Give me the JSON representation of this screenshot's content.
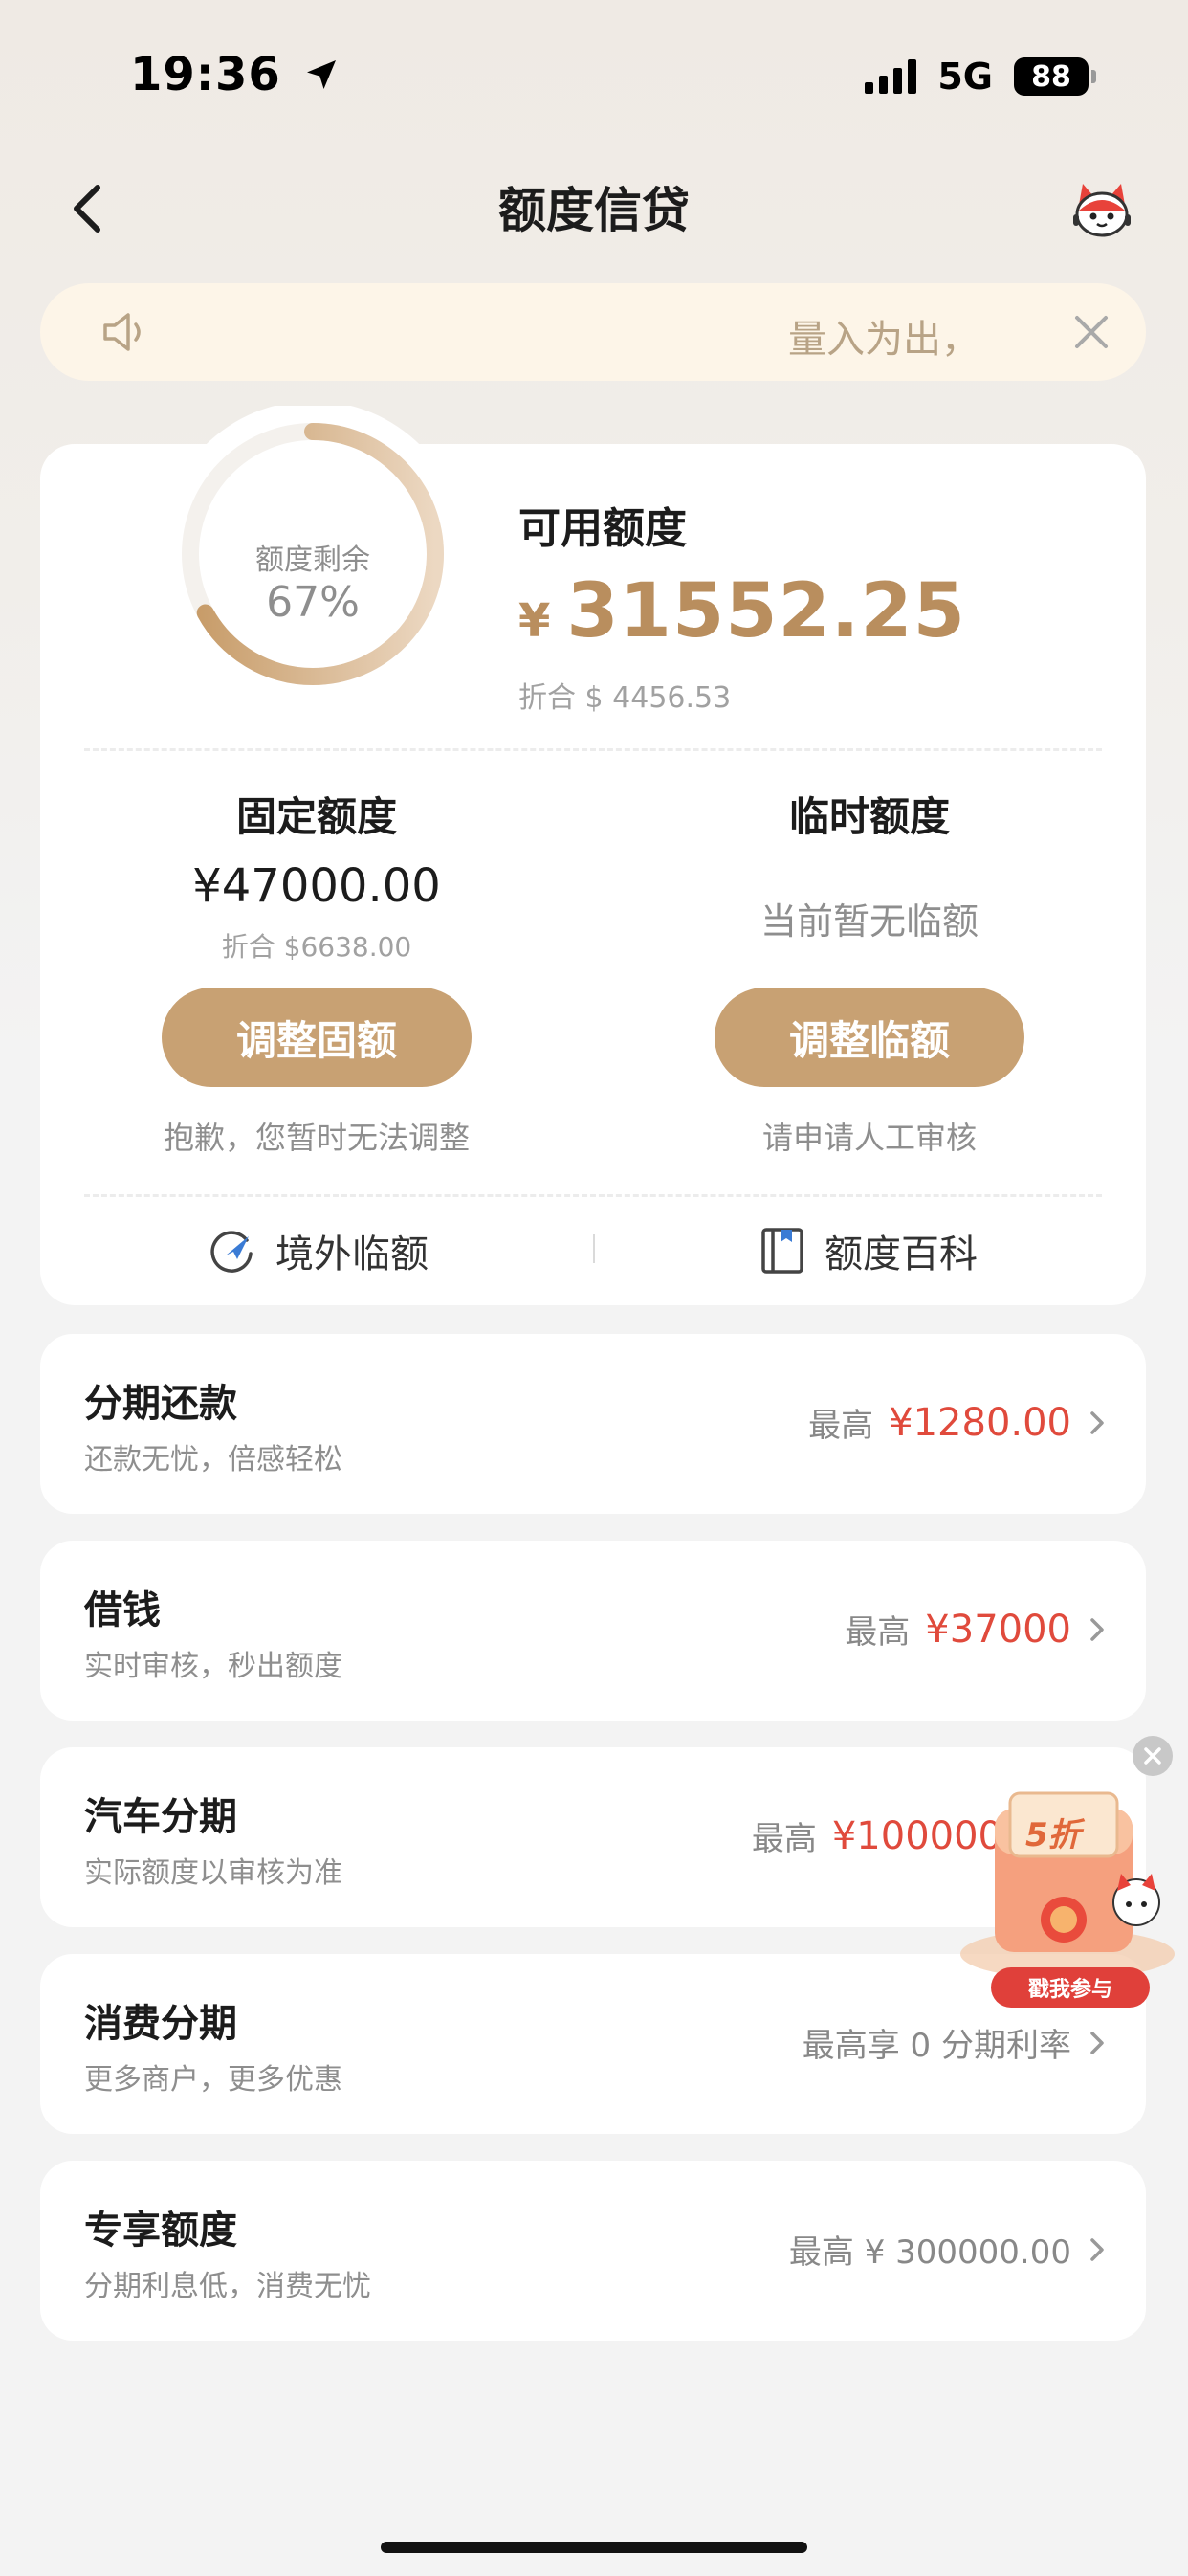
{
  "status_bar": {
    "time": "19:36",
    "network": "5G",
    "battery": "88"
  },
  "nav": {
    "title": "额度信贷"
  },
  "notice": {
    "text": "量入为出，"
  },
  "credit": {
    "gauge_label": "额度剩余",
    "gauge_percent_text": "67%",
    "gauge_fraction": 0.67,
    "available_title": "可用额度",
    "currency_symbol": "¥",
    "available_amount": "31552.25",
    "available_converted": "折合 $ 4456.53",
    "fixed": {
      "title": "固定额度",
      "amount": "¥47000.00",
      "converted": "折合 $6638.00",
      "button": "调整固额",
      "note": "抱歉，您暂时无法调整"
    },
    "temporary": {
      "title": "临时额度",
      "status": "当前暂无临额",
      "button": "调整临额",
      "note": "请申请人工审核"
    },
    "tools": {
      "overseas": "境外临额",
      "wiki": "额度百科"
    }
  },
  "rows": [
    {
      "title": "分期还款",
      "subtitle": "还款无忧，倍感轻松",
      "prefix": "最高",
      "amount": "¥1280.00"
    },
    {
      "title": "借钱",
      "subtitle": "实时审核，秒出额度",
      "prefix": "最高",
      "amount": "¥37000"
    },
    {
      "title": "汽车分期",
      "subtitle": "实际额度以审核为准",
      "prefix": "最高",
      "amount": "¥100000"
    },
    {
      "title": "消费分期",
      "subtitle": "更多商户，更多优惠",
      "prefix": "最高享 0 分期利率",
      "amount": ""
    },
    {
      "title": "专享额度",
      "subtitle": "分期利息低，消费无忧",
      "prefix": "最高 ¥ 300000.00",
      "amount": ""
    }
  ],
  "promo": {
    "badge": "5折",
    "button": "戳我参与"
  },
  "colors": {
    "gold": "#c8a173",
    "amount_gold": "#b98e5e",
    "red": "#e04a3c"
  }
}
